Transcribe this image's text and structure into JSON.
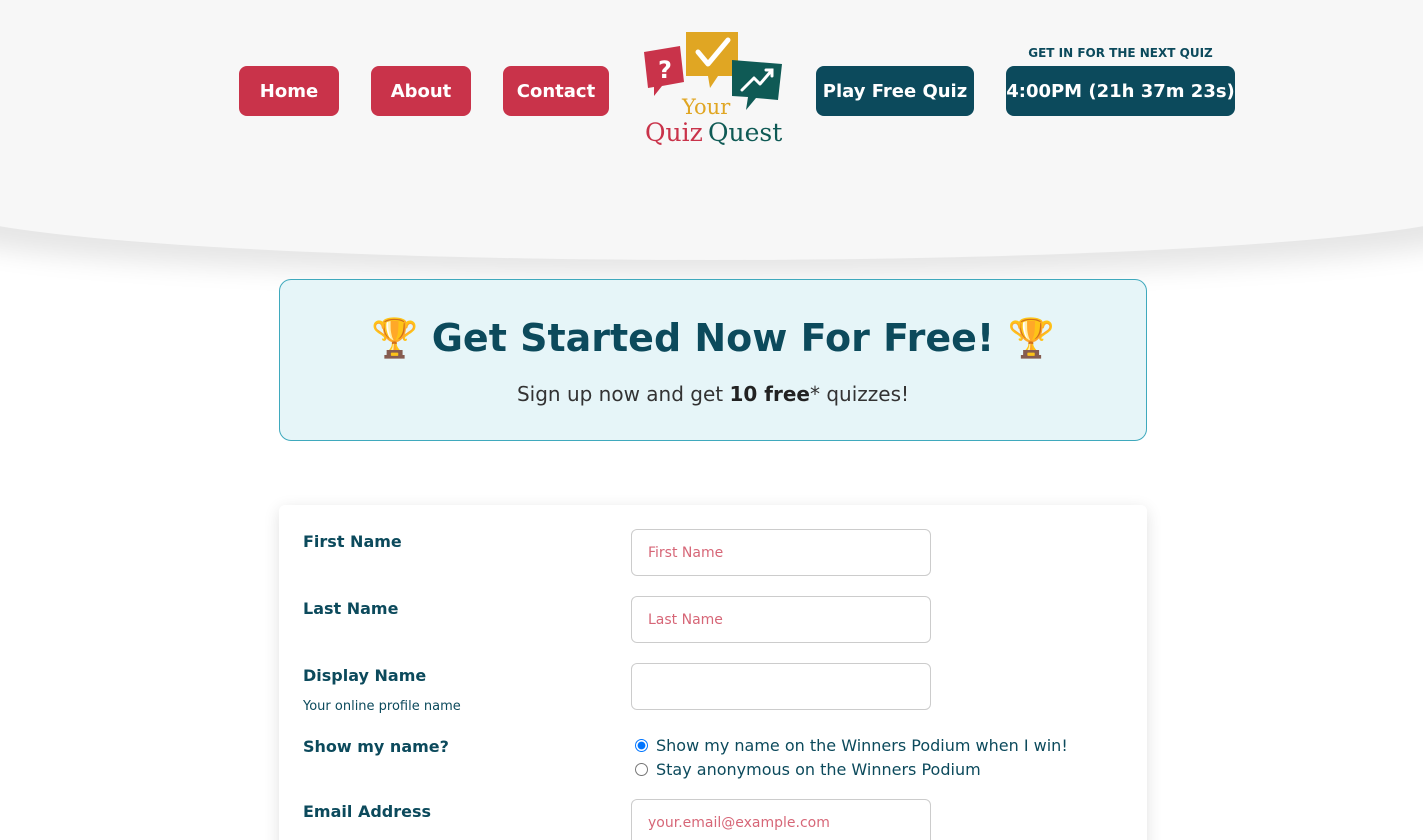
{
  "nav": {
    "home": "Home",
    "about": "About",
    "contact": "Contact",
    "play": "Play Free Quiz",
    "timer_label": "GET IN FOR THE NEXT QUIZ",
    "timer": "4:00PM (21h 37m 23s)"
  },
  "logo": {
    "line1": "Your",
    "line2a": "Quiz",
    "line2b": "Quest",
    "colors": {
      "red": "#c9334a",
      "gold": "#e0a623",
      "teal": "#0f5a55"
    }
  },
  "banner": {
    "title": "Get Started Now For Free!",
    "sub_before": "Sign up now and get ",
    "sub_bold": "10 free",
    "sub_after": "* quizzes!"
  },
  "form": {
    "first_name": {
      "label": "First Name",
      "placeholder": "First Name"
    },
    "last_name": {
      "label": "Last Name",
      "placeholder": "Last Name"
    },
    "display_name": {
      "label": "Display Name",
      "hint": "Your online profile name",
      "placeholder": ""
    },
    "show_name": {
      "label": "Show my name?",
      "option_show": "Show my name on the Winners Podium when I win!",
      "option_anon": "Stay anonymous on the Winners Podium"
    },
    "email": {
      "label": "Email Address",
      "placeholder": "your.email@example.com"
    }
  },
  "colors": {
    "primary_red": "#c9334a",
    "primary_dark": "#0c4a5c",
    "banner_bg": "#e6f5f8"
  }
}
